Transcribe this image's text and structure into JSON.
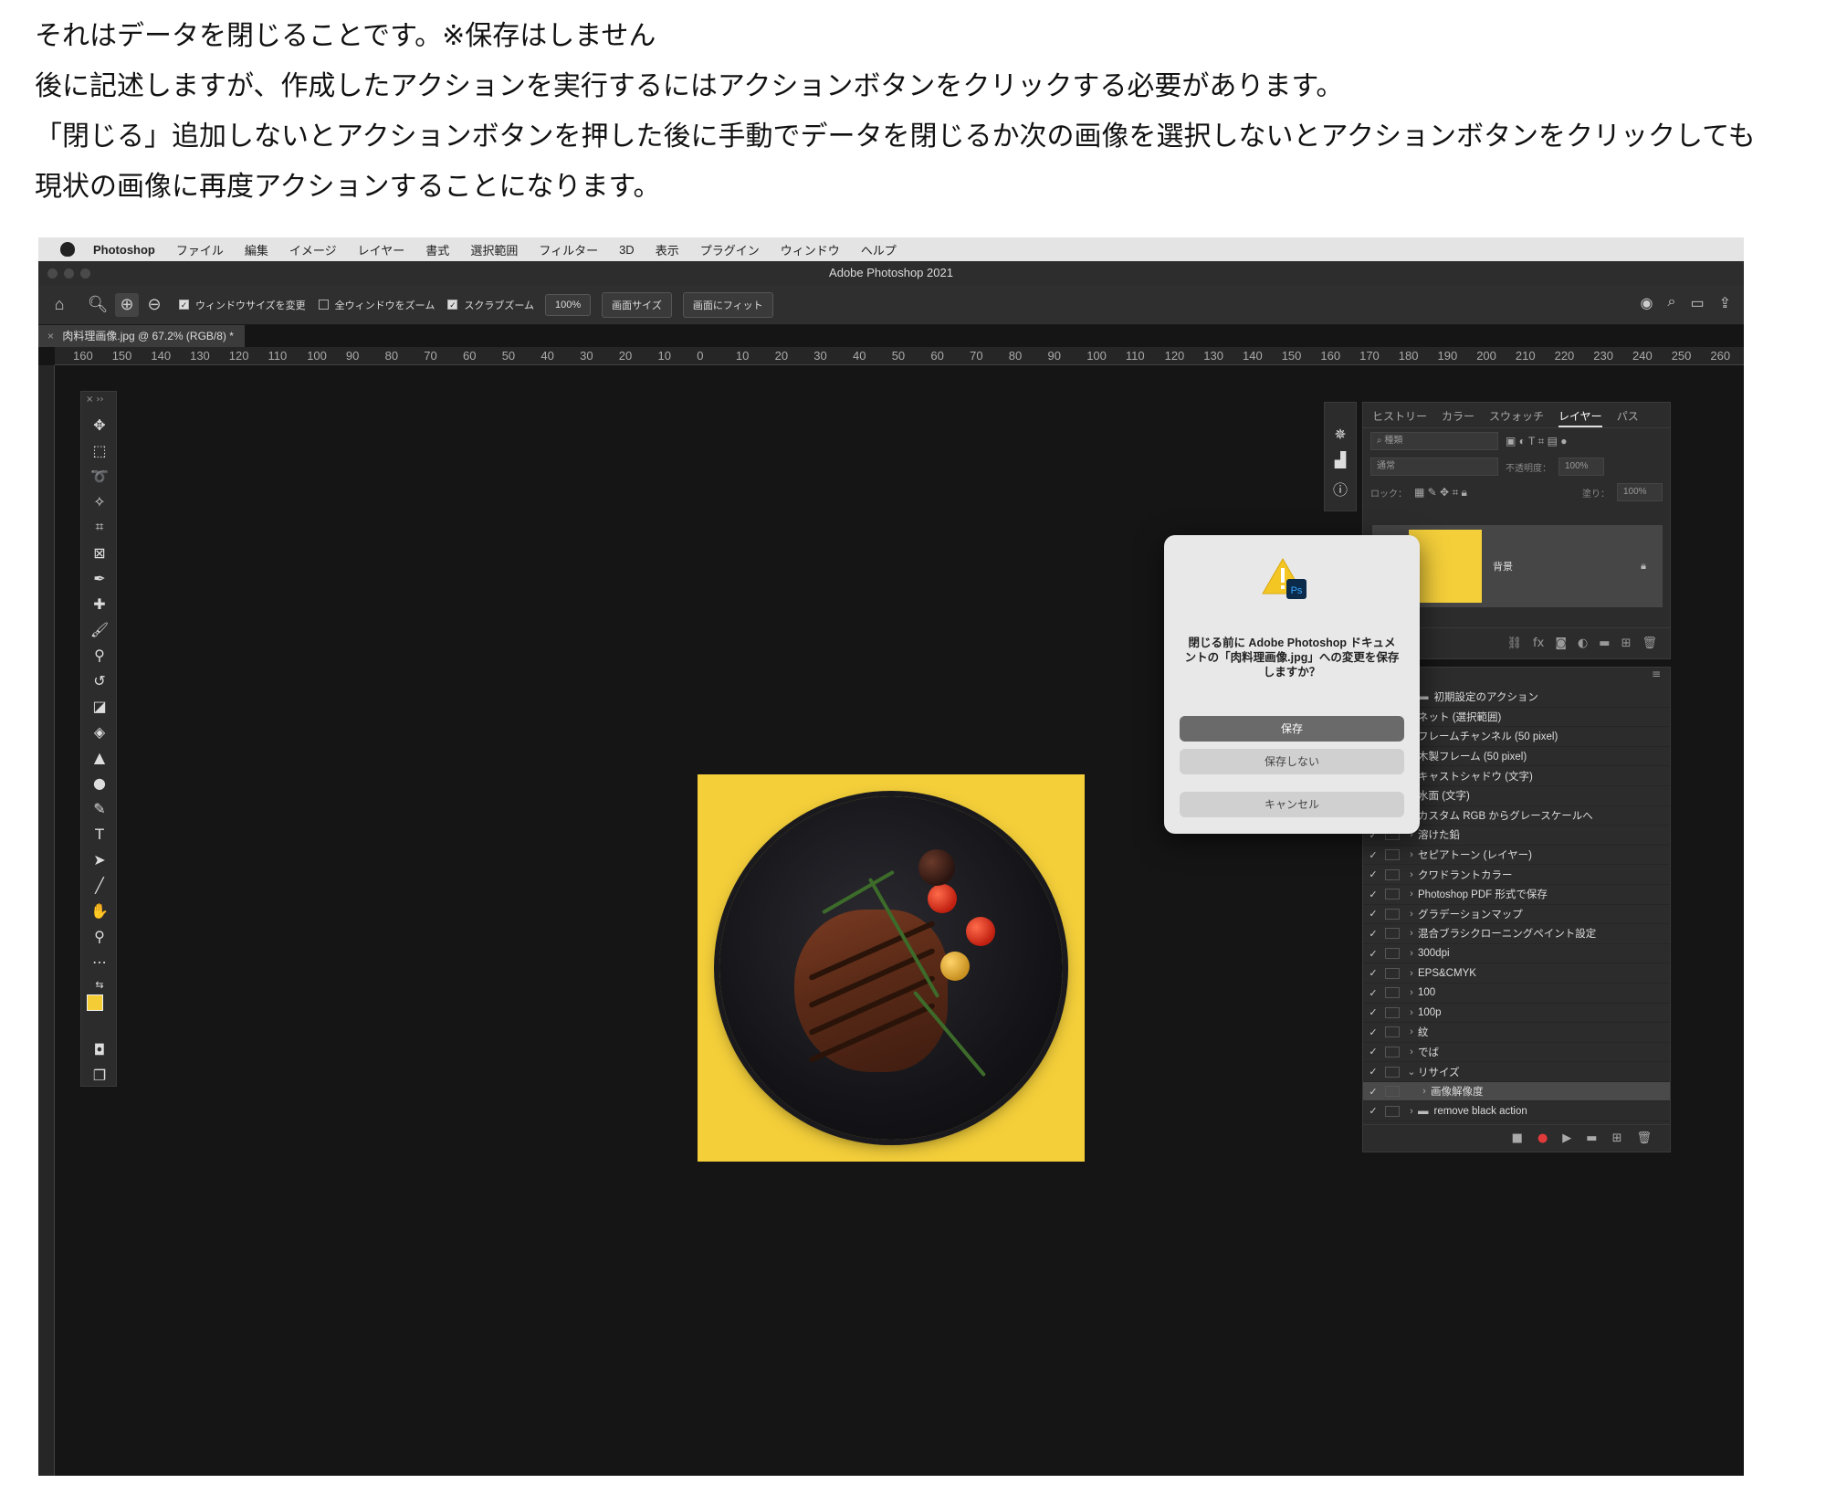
{
  "article": {
    "lines": [
      "それはデータを閉じることです。※保存はしません",
      "後に記述しますが、作成したアクションを実行するにはアクションボタンをクリックする必要があります。",
      "「閉じる」追加しないとアクションボタンを押した後に手動でデータを閉じるか次の画像を選択しないとアクションボタンをクリックしても",
      "現状の画像に再度アクションすることになります。"
    ]
  },
  "menubar": {
    "app": "Photoshop",
    "items": [
      "ファイル",
      "編集",
      "イメージ",
      "レイヤー",
      "書式",
      "選択範囲",
      "フィルター",
      "3D",
      "表示",
      "プラグイン",
      "ウィンドウ",
      "ヘルプ"
    ]
  },
  "window": {
    "title": "Adobe Photoshop 2021"
  },
  "options": {
    "resize_window": "ウィンドウサイズを変更",
    "zoom_all": "全ウィンドウをズーム",
    "scrubby_zoom": "スクラブズーム",
    "zoom_value": "100%",
    "fit_screen": "画面サイズ",
    "fill_screen": "画面にフィット"
  },
  "doc_tab": "肉料理画像.jpg @ 67.2% (RGB/8) *",
  "ruler_ticks": [
    "160",
    "150",
    "140",
    "130",
    "120",
    "110",
    "100",
    "90",
    "80",
    "70",
    "60",
    "50",
    "40",
    "30",
    "20",
    "10",
    "0",
    "10",
    "20",
    "30",
    "40",
    "50",
    "60",
    "70",
    "80",
    "90",
    "100",
    "110",
    "120",
    "130",
    "140",
    "150",
    "160",
    "170",
    "180",
    "190",
    "200",
    "210",
    "220",
    "230",
    "240",
    "250",
    "260"
  ],
  "layers_panel": {
    "tabs": [
      "ヒストリー",
      "カラー",
      "スウォッチ",
      "レイヤー",
      "パス"
    ],
    "active_tab": "レイヤー",
    "kind_placeholder": "種類",
    "blend_mode": "通常",
    "opacity_label": "不透明度：",
    "opacity_value": "100%",
    "lock_label": "ロック：",
    "fill_label": "塗り：",
    "fill_value": "100%",
    "layer_name": "背景"
  },
  "actions_panel": {
    "items": [
      {
        "label": "初期設定のアクション",
        "type": "set",
        "sel": false
      },
      {
        "label": "ネット (選択範囲)",
        "type": "action",
        "sel": false
      },
      {
        "label": "フレームチャンネル (50 pixel)",
        "type": "action",
        "sel": false
      },
      {
        "label": "木製フレーム (50 pixel)",
        "type": "action",
        "sel": false
      },
      {
        "label": "キャストシャドウ (文字)",
        "type": "action",
        "sel": false
      },
      {
        "label": "水面 (文字)",
        "type": "action",
        "sel": false
      },
      {
        "label": "カスタム RGB からグレースケールへ",
        "type": "action",
        "sel": false
      },
      {
        "label": "溶けた鉛",
        "type": "action",
        "sel": false
      },
      {
        "label": "セピアトーン (レイヤー)",
        "type": "action",
        "sel": false
      },
      {
        "label": "クワドラントカラー",
        "type": "action",
        "sel": false
      },
      {
        "label": "Photoshop PDF 形式で保存",
        "type": "action",
        "sel": false
      },
      {
        "label": "グラデーションマップ",
        "type": "action",
        "sel": false
      },
      {
        "label": "混合ブラシクローニングペイント設定",
        "type": "action",
        "sel": false
      },
      {
        "label": "300dpi",
        "type": "action",
        "sel": false
      },
      {
        "label": "EPS&CMYK",
        "type": "action",
        "sel": false
      },
      {
        "label": "100",
        "type": "action",
        "sel": false
      },
      {
        "label": "100p",
        "type": "action",
        "sel": false
      },
      {
        "label": "紋",
        "type": "action",
        "sel": false
      },
      {
        "label": "でば",
        "type": "action",
        "sel": false
      },
      {
        "label": "リサイズ",
        "type": "action-open",
        "sel": false
      },
      {
        "label": "画像解像度",
        "type": "step",
        "sel": true
      },
      {
        "label": "remove black action",
        "type": "set",
        "sel": false
      }
    ]
  },
  "dialog": {
    "message": "閉じる前に Adobe Photoshop ドキュメントの「肉料理画像.jpg」への変更を保存しますか？",
    "save": "保存",
    "dont_save": "保存しない",
    "cancel": "キャンセル",
    "badge": "Ps"
  },
  "colors": {
    "foreground": "#f4cc35",
    "background": "#000000",
    "accent": "#f4cf3a"
  }
}
